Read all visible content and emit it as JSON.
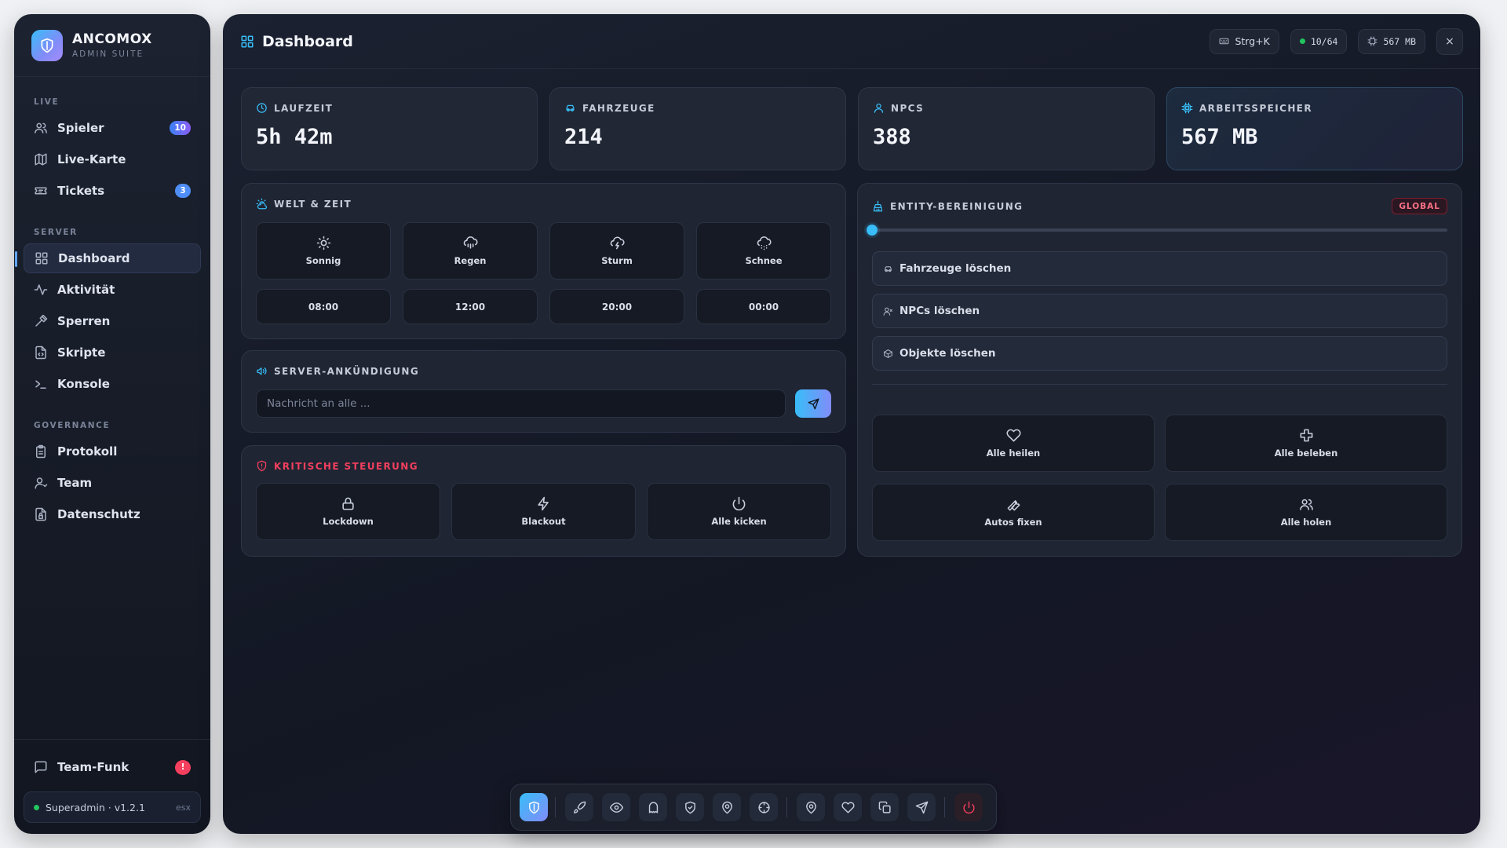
{
  "app": {
    "name": "ANCOMOX",
    "subtitle": "ADMIN SUITE"
  },
  "sidebar": {
    "sections": [
      {
        "title": "LIVE",
        "items": [
          {
            "label": "Spieler",
            "icon": "users-icon",
            "badge": "10"
          },
          {
            "label": "Live-Karte",
            "icon": "map-icon"
          },
          {
            "label": "Tickets",
            "icon": "ticket-icon",
            "badge": "3"
          }
        ]
      },
      {
        "title": "SERVER",
        "items": [
          {
            "label": "Dashboard",
            "icon": "grid-icon",
            "active": true
          },
          {
            "label": "Aktivität",
            "icon": "activity-icon"
          },
          {
            "label": "Sperren",
            "icon": "gavel-icon"
          },
          {
            "label": "Skripte",
            "icon": "file-code-icon"
          },
          {
            "label": "Konsole",
            "icon": "terminal-icon"
          }
        ]
      },
      {
        "title": "GOVERNANCE",
        "items": [
          {
            "label": "Protokoll",
            "icon": "clipboard-icon"
          },
          {
            "label": "Team",
            "icon": "user-icon"
          },
          {
            "label": "Datenschutz",
            "icon": "file-lock-icon"
          }
        ]
      }
    ],
    "team_radio": {
      "label": "Team-Funk",
      "badge": "!"
    },
    "user": {
      "label": "Superadmin · v1.2.1",
      "tag": "esx"
    }
  },
  "header": {
    "title": "Dashboard",
    "shortcut": "Strg+K",
    "players": "10/64",
    "memory": "567 MB",
    "close": "×"
  },
  "stats": [
    {
      "label": "LAUFZEIT",
      "value": "5h 42m",
      "icon": "clock-icon"
    },
    {
      "label": "FAHRZEUGE",
      "value": "214",
      "icon": "car-icon"
    },
    {
      "label": "NPCS",
      "value": "388",
      "icon": "user-icon"
    },
    {
      "label": "ARBEITSSPEICHER",
      "value": "567 MB",
      "icon": "cpu-icon"
    }
  ],
  "weather": {
    "title": "WELT & ZEIT",
    "options": [
      {
        "label": "Sonnig",
        "icon": "sun-icon"
      },
      {
        "label": "Regen",
        "icon": "cloud-rain-icon"
      },
      {
        "label": "Sturm",
        "icon": "cloud-lightning-icon"
      },
      {
        "label": "Schnee",
        "icon": "cloud-snow-icon"
      }
    ],
    "times": [
      "08:00",
      "12:00",
      "20:00",
      "00:00"
    ]
  },
  "announcement": {
    "title": "SERVER-ANKÜNDIGUNG",
    "placeholder": "Nachricht an alle ..."
  },
  "critical": {
    "title": "KRITISCHE STEUERUNG",
    "actions": [
      {
        "label": "Lockdown",
        "icon": "lock-icon"
      },
      {
        "label": "Blackout",
        "icon": "zap-icon"
      },
      {
        "label": "Alle kicken",
        "icon": "power-icon"
      }
    ]
  },
  "cleanup": {
    "title": "ENTITY-BEREINIGUNG",
    "badge": "GLOBAL",
    "slider_value": 0,
    "rows": [
      {
        "label": "Fahrzeuge löschen",
        "icon": "car-icon"
      },
      {
        "label": "NPCs löschen",
        "icon": "user-x-icon"
      },
      {
        "label": "Objekte löschen",
        "icon": "box-icon"
      }
    ],
    "actions": [
      {
        "label": "Alle heilen",
        "icon": "heart-icon"
      },
      {
        "label": "Alle beleben",
        "icon": "cross-icon"
      },
      {
        "label": "Autos fixen",
        "icon": "wrench-icon"
      },
      {
        "label": "Alle holen",
        "icon": "users-icon"
      }
    ]
  },
  "dock": {
    "items": [
      "shield-icon",
      "rocket-icon",
      "eye-icon",
      "ghost-icon",
      "shield-check-icon",
      "map-pin-icon",
      "crosshair-icon",
      "map-pin-icon",
      "heart-icon",
      "copy-icon",
      "navigation-icon",
      "power-icon"
    ]
  },
  "colors": {
    "accent": "#38bdf8",
    "accent2": "#818cf8",
    "danger": "#f43f5e",
    "online": "#22c55e"
  }
}
